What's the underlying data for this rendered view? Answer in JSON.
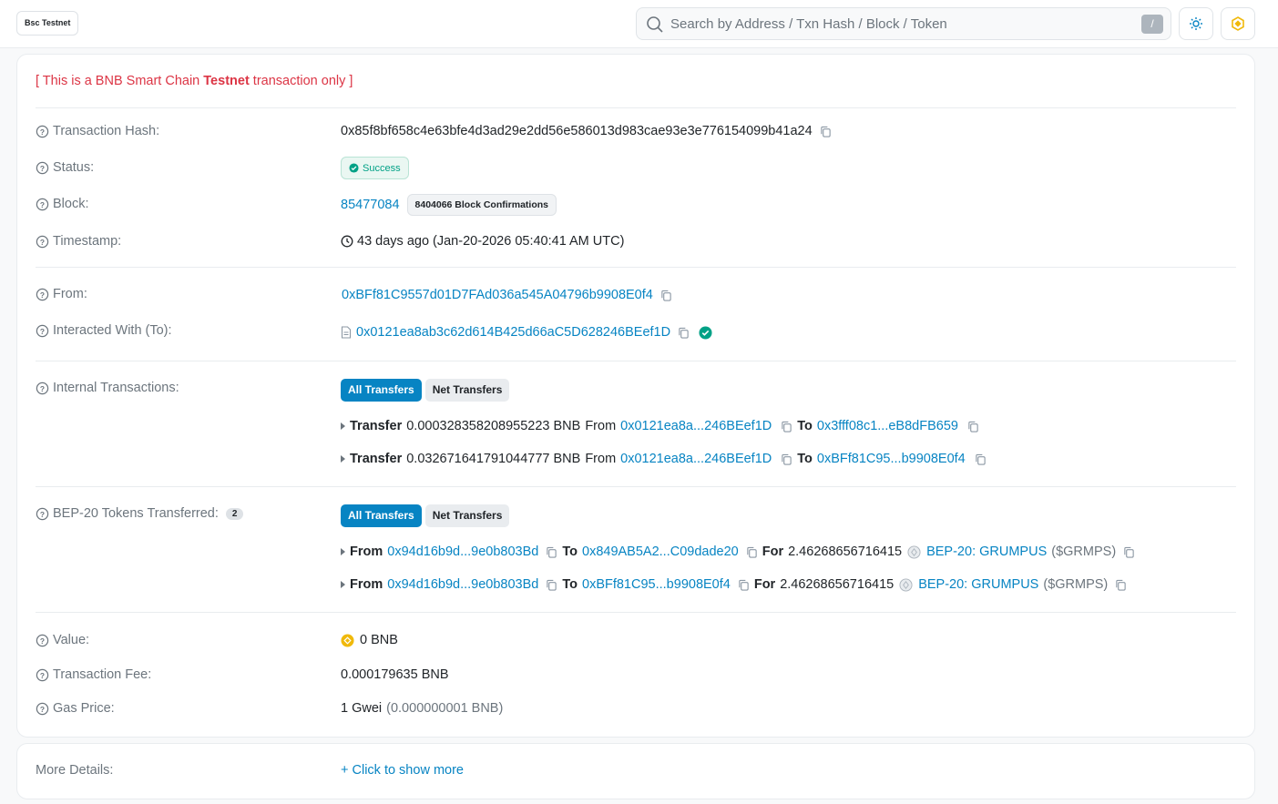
{
  "header": {
    "network_badge": "Bsc Testnet",
    "search_placeholder": "Search by Address / Txn Hash / Block / Token",
    "search_shortcut": "/"
  },
  "notice": {
    "prefix": "[ This is a BNB Smart Chain ",
    "emphasis": "Testnet",
    "suffix": " transaction only ]"
  },
  "tx": {
    "hash_label": "Transaction Hash:",
    "hash": "0x85f8bf658c4e63bfe4d3ad29e2dd56e586013d983cae93e3e776154099b41a24",
    "status_label": "Status:",
    "status": "Success",
    "block_label": "Block:",
    "block": "85477084",
    "confirmations": "8404066 Block Confirmations",
    "timestamp_label": "Timestamp:",
    "timestamp": "43 days ago (Jan-20-2026 05:40:41 AM UTC)",
    "from_label": "From:",
    "from": "0xBFf81C9557d01D7FAd036a545A04796b9908E0f4",
    "to_label": "Interacted With (To):",
    "to": "0x0121ea8ab3c62d614B425d66aC5D628246BEef1D",
    "internal_label": "Internal Transactions:",
    "tab_all": "All Transfers",
    "tab_net": "Net Transfers",
    "internal_transfers": [
      {
        "kw": "Transfer",
        "amount": "0.000328358208955223 BNB",
        "from_kw": "From",
        "from": "0x0121ea8a...246BEef1D",
        "to_kw": "To",
        "to": "0x3fff08c1...eB8dFB659"
      },
      {
        "kw": "Transfer",
        "amount": "0.032671641791044777 BNB",
        "from_kw": "From",
        "from": "0x0121ea8a...246BEef1D",
        "to_kw": "To",
        "to": "0xBFf81C95...b9908E0f4"
      }
    ],
    "tokens_label": "BEP-20 Tokens Transferred:",
    "tokens_count": "2",
    "token_transfers": [
      {
        "from_kw": "From",
        "from": "0x94d16b9d...9e0b803Bd",
        "to_kw": "To",
        "to": "0x849AB5A2...C09dade20",
        "for_kw": "For",
        "amount": "2.46268656716415",
        "token": "BEP-20: GRUMPUS",
        "symbol": "($GRMPS)"
      },
      {
        "from_kw": "From",
        "from": "0x94d16b9d...9e0b803Bd",
        "to_kw": "To",
        "to": "0xBFf81C95...b9908E0f4",
        "for_kw": "For",
        "amount": "2.46268656716415",
        "token": "BEP-20: GRUMPUS",
        "symbol": "($GRMPS)"
      }
    ],
    "value_label": "Value:",
    "value": "0 BNB",
    "fee_label": "Transaction Fee:",
    "fee": "0.000179635 BNB",
    "gas_label": "Gas Price:",
    "gas": "1 Gwei",
    "gas_detail": "(0.000000001 BNB)"
  },
  "more": {
    "label": "More Details:",
    "link": "+ Click to show more"
  },
  "colors": {
    "link": "#0784c3",
    "success": "#00a186",
    "danger": "#dc3545",
    "bnb": "#f0b90b"
  }
}
